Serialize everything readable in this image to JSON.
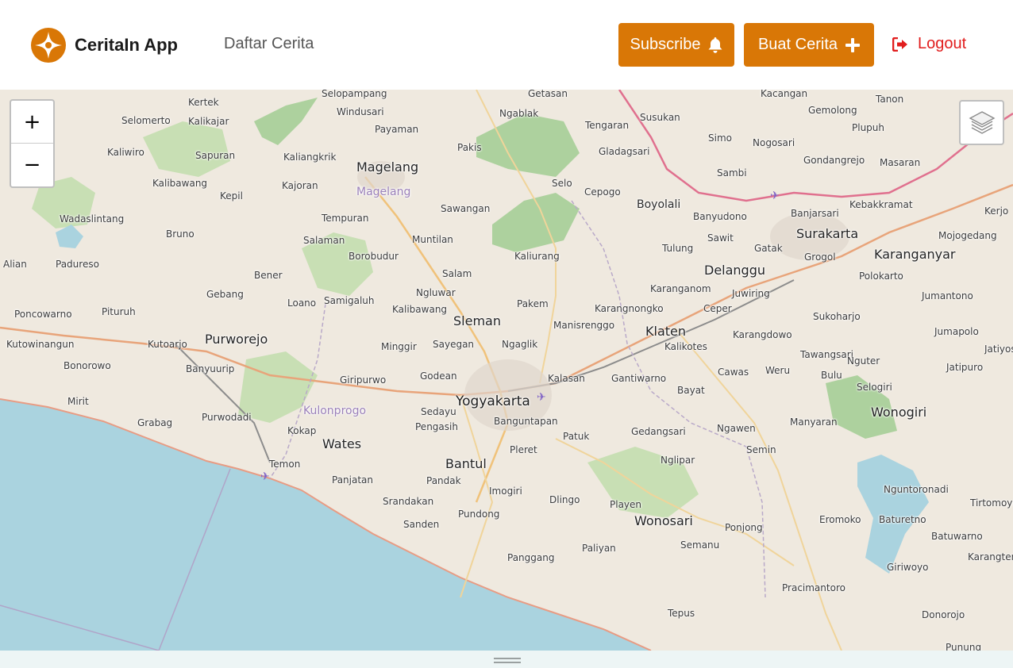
{
  "header": {
    "app_name": "CeritaIn App",
    "nav_link": "Daftar Cerita",
    "subscribe_label": "Subscribe",
    "create_label": "Buat Cerita",
    "logout_label": "Logout"
  },
  "colors": {
    "accent": "#d97706",
    "logout": "#e11d1d",
    "sea": "#aad3df",
    "land": "#efe9df"
  },
  "icons": {
    "brand": "compass-star-icon",
    "subscribe": "bell-icon",
    "create": "plus-icon",
    "logout": "sign-out-icon",
    "layers": "layers-icon"
  },
  "map": {
    "zoom_in": "+",
    "zoom_out": "−",
    "places": [
      {
        "name": "Selopampang",
        "size": "s"
      },
      {
        "name": "Getasan",
        "size": "s"
      },
      {
        "name": "Kacangan",
        "size": "s"
      },
      {
        "name": "Tanon",
        "size": "s"
      },
      {
        "name": "Kertek",
        "size": "s"
      },
      {
        "name": "Windusari",
        "size": "s"
      },
      {
        "name": "Ngablak",
        "size": "s"
      },
      {
        "name": "Gemolong",
        "size": "s"
      },
      {
        "name": "Selomerto",
        "size": "s"
      },
      {
        "name": "Kalikajar",
        "size": "s"
      },
      {
        "name": "Payaman",
        "size": "s"
      },
      {
        "name": "Susukan",
        "size": "s"
      },
      {
        "name": "Tengaran",
        "size": "s"
      },
      {
        "name": "Plupuh",
        "size": "s"
      },
      {
        "name": "Simo",
        "size": "s"
      },
      {
        "name": "Nogosari",
        "size": "s"
      },
      {
        "name": "Pakis",
        "size": "s"
      },
      {
        "name": "Kaliwiro",
        "size": "s"
      },
      {
        "name": "Sapuran",
        "size": "s"
      },
      {
        "name": "Kaliangkrik",
        "size": "s"
      },
      {
        "name": "Gladagsari",
        "size": "s"
      },
      {
        "name": "Gondangrejo",
        "size": "s"
      },
      {
        "name": "Magelang",
        "size": "l"
      },
      {
        "name": "Masaran",
        "size": "s"
      },
      {
        "name": "Sambi",
        "size": "s"
      },
      {
        "name": "Kalibawang",
        "size": "s"
      },
      {
        "name": "Kajoran",
        "size": "s"
      },
      {
        "name": "Selo",
        "size": "s"
      },
      {
        "name": "Cepogo",
        "size": "s"
      },
      {
        "name": "Kepil",
        "size": "s"
      },
      {
        "name": "Magelang",
        "size": "purple"
      },
      {
        "name": "Boyolali",
        "size": "m"
      },
      {
        "name": "Kebakkramat",
        "size": "s"
      },
      {
        "name": "Sawangan",
        "size": "s"
      },
      {
        "name": "Banyudono",
        "size": "s"
      },
      {
        "name": "Banjarsari",
        "size": "s"
      },
      {
        "name": "Wadaslintang",
        "size": "s"
      },
      {
        "name": "Tempuran",
        "size": "s"
      },
      {
        "name": "Kerjo",
        "size": "s"
      },
      {
        "name": "Bruno",
        "size": "s"
      },
      {
        "name": "Surakarta",
        "size": "l"
      },
      {
        "name": "Sawit",
        "size": "s"
      },
      {
        "name": "Mojogedang",
        "size": "s"
      },
      {
        "name": "Salaman",
        "size": "s"
      },
      {
        "name": "Muntilan",
        "size": "s"
      },
      {
        "name": "Tulung",
        "size": "s"
      },
      {
        "name": "Gatak",
        "size": "s"
      },
      {
        "name": "Padureso",
        "size": "s"
      },
      {
        "name": "Borobudur",
        "size": "s"
      },
      {
        "name": "Kaliurang",
        "size": "s"
      },
      {
        "name": "Karanganyar",
        "size": "l"
      },
      {
        "name": "Grogol",
        "size": "s"
      },
      {
        "name": "Alian",
        "size": "s"
      },
      {
        "name": "Delanggu",
        "size": "l"
      },
      {
        "name": "Bener",
        "size": "s"
      },
      {
        "name": "Salam",
        "size": "s"
      },
      {
        "name": "Polokarto",
        "size": "s"
      },
      {
        "name": "Karanganom",
        "size": "s"
      },
      {
        "name": "Gebang",
        "size": "s"
      },
      {
        "name": "Ngluwar",
        "size": "s"
      },
      {
        "name": "Juwiring",
        "size": "s"
      },
      {
        "name": "Jumantono",
        "size": "s"
      },
      {
        "name": "Loano",
        "size": "s"
      },
      {
        "name": "Samigaluh",
        "size": "s"
      },
      {
        "name": "Pakem",
        "size": "s"
      },
      {
        "name": "Ceper",
        "size": "s"
      },
      {
        "name": "Karangnongko",
        "size": "s"
      },
      {
        "name": "Poncowarno",
        "size": "s"
      },
      {
        "name": "Pituruh",
        "size": "s"
      },
      {
        "name": "Kalibawang",
        "size": "s"
      },
      {
        "name": "Sukoharjo",
        "size": "s"
      },
      {
        "name": "Sleman",
        "size": "l"
      },
      {
        "name": "Manisrenggo",
        "size": "s"
      },
      {
        "name": "Klaten",
        "size": "l"
      },
      {
        "name": "Karangdowo",
        "size": "s"
      },
      {
        "name": "Jumapolo",
        "size": "s"
      },
      {
        "name": "Kutowinangun",
        "size": "s"
      },
      {
        "name": "Kutoarjo",
        "size": "s"
      },
      {
        "name": "Purworejo",
        "size": "l"
      },
      {
        "name": "Minggir",
        "size": "s"
      },
      {
        "name": "Sayegan",
        "size": "s"
      },
      {
        "name": "Ngaglik",
        "size": "s"
      },
      {
        "name": "Kalikotes",
        "size": "s"
      },
      {
        "name": "Tawangsari",
        "size": "s"
      },
      {
        "name": "Jatiyoso",
        "size": "s"
      },
      {
        "name": "Bonorowo",
        "size": "s"
      },
      {
        "name": "Banyuurip",
        "size": "s"
      },
      {
        "name": "Nguter",
        "size": "s"
      },
      {
        "name": "Jatipuro",
        "size": "s"
      },
      {
        "name": "Cawas",
        "size": "s"
      },
      {
        "name": "Weru",
        "size": "s"
      },
      {
        "name": "Bulu",
        "size": "s"
      },
      {
        "name": "Godean",
        "size": "s"
      },
      {
        "name": "Kalasan",
        "size": "s"
      },
      {
        "name": "Gantiwarno",
        "size": "s"
      },
      {
        "name": "Giripurwo",
        "size": "s"
      },
      {
        "name": "Selogiri",
        "size": "s"
      },
      {
        "name": "Bayat",
        "size": "s"
      },
      {
        "name": "Mirit",
        "size": "s"
      },
      {
        "name": "Yogyakarta",
        "size": "xl"
      },
      {
        "name": "Wonogiri",
        "size": "l"
      },
      {
        "name": "Kulonprogo",
        "size": "purple"
      },
      {
        "name": "Sedayu",
        "size": "s"
      },
      {
        "name": "Grabag",
        "size": "s"
      },
      {
        "name": "Purwodadi",
        "size": "s"
      },
      {
        "name": "Banguntapan",
        "size": "s"
      },
      {
        "name": "Pengasih",
        "size": "s"
      },
      {
        "name": "Manyaran",
        "size": "s"
      },
      {
        "name": "Ngawen",
        "size": "s"
      },
      {
        "name": "Kokap",
        "size": "s"
      },
      {
        "name": "Gedangsari",
        "size": "s"
      },
      {
        "name": "Patuk",
        "size": "s"
      },
      {
        "name": "Wates",
        "size": "l"
      },
      {
        "name": "Pleret",
        "size": "s"
      },
      {
        "name": "Semin",
        "size": "s"
      },
      {
        "name": "Temon",
        "size": "s"
      },
      {
        "name": "Nglipar",
        "size": "s"
      },
      {
        "name": "Bantul",
        "size": "l"
      },
      {
        "name": "Panjatan",
        "size": "s"
      },
      {
        "name": "Pandak",
        "size": "s"
      },
      {
        "name": "Imogiri",
        "size": "s"
      },
      {
        "name": "Nguntoronadi",
        "size": "s"
      },
      {
        "name": "Srandakan",
        "size": "s"
      },
      {
        "name": "Dlingo",
        "size": "s"
      },
      {
        "name": "Playen",
        "size": "s"
      },
      {
        "name": "Tirtomoyo",
        "size": "s"
      },
      {
        "name": "Pundong",
        "size": "s"
      },
      {
        "name": "Wonosari",
        "size": "l"
      },
      {
        "name": "Eromoko",
        "size": "s"
      },
      {
        "name": "Baturetno",
        "size": "s"
      },
      {
        "name": "Sanden",
        "size": "s"
      },
      {
        "name": "Ponjong",
        "size": "s"
      },
      {
        "name": "Batuwarno",
        "size": "s"
      },
      {
        "name": "Paliyan",
        "size": "s"
      },
      {
        "name": "Semanu",
        "size": "s"
      },
      {
        "name": "Karangtengah",
        "size": "s"
      },
      {
        "name": "Panggang",
        "size": "s"
      },
      {
        "name": "Giriwoyo",
        "size": "s"
      },
      {
        "name": "Pracimantoro",
        "size": "s"
      },
      {
        "name": "Tepus",
        "size": "s"
      },
      {
        "name": "Donorojo",
        "size": "s"
      },
      {
        "name": "Punung",
        "size": "s"
      }
    ]
  }
}
